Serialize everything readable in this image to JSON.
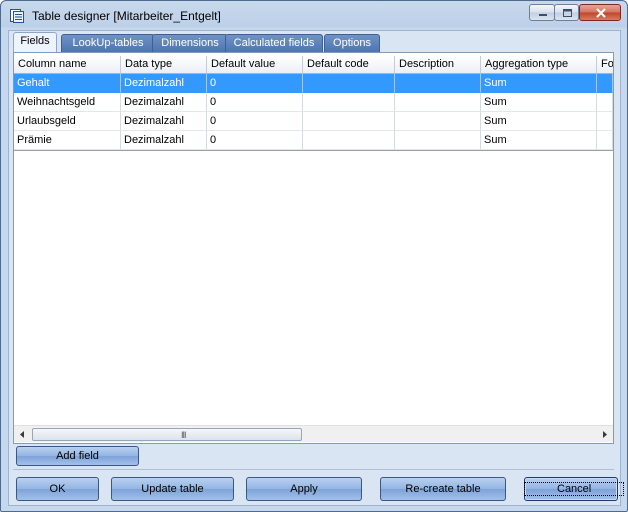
{
  "window": {
    "title": "Table designer [Mitarbeiter_Entgelt]",
    "icon": "table-designer-icon",
    "controls": [
      "minimize-icon",
      "maximize-icon",
      "close-icon"
    ]
  },
  "tabs": [
    {
      "label": "Fields",
      "active": true
    },
    {
      "label": "LookUp-tables",
      "active": false
    },
    {
      "label": "Dimensions",
      "active": false
    },
    {
      "label": "Calculated fields",
      "active": false
    },
    {
      "label": "Options",
      "active": false
    }
  ],
  "grid": {
    "columns": [
      "Column name",
      "Data type",
      "Default value",
      "Default code",
      "Description",
      "Aggregation type",
      "Fo"
    ],
    "rows": [
      {
        "cells": [
          "Gehalt",
          "Dezimalzahl",
          "0",
          "",
          "",
          "Sum",
          ""
        ],
        "selected": true
      },
      {
        "cells": [
          "Weihnachtsgeld",
          "Dezimalzahl",
          "0",
          "",
          "",
          "Sum",
          ""
        ],
        "selected": false
      },
      {
        "cells": [
          "Urlaubsgeld",
          "Dezimalzahl",
          "0",
          "",
          "",
          "Sum",
          ""
        ],
        "selected": false
      },
      {
        "cells": [
          "Prämie",
          "Dezimalzahl",
          "0",
          "",
          "",
          "Sum",
          ""
        ],
        "selected": false
      }
    ],
    "scrollbar_grip": "III"
  },
  "buttons": {
    "add_field": "Add field",
    "ok": "OK",
    "update_table": "Update table",
    "apply": "Apply",
    "recreate_table": "Re-create table",
    "cancel": "Cancel"
  },
  "colors": {
    "selection": "#3399ff",
    "tab_inactive": "#5a7fb8",
    "button": "#93b4e2"
  }
}
